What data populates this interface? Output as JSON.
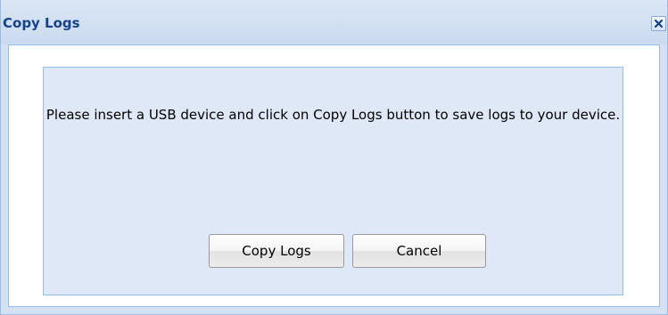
{
  "dialog": {
    "title": "Copy Logs",
    "close_icon": "close-icon",
    "message": "Please insert a USB device and click on Copy Logs button to save logs to your device.",
    "buttons": {
      "copy_label": "Copy Logs",
      "cancel_label": "Cancel"
    }
  },
  "colors": {
    "title_text": "#15428b",
    "titlebar_bg": "#d4e1f2",
    "content_bg": "#dfe8f6",
    "border": "#99bbe8"
  }
}
